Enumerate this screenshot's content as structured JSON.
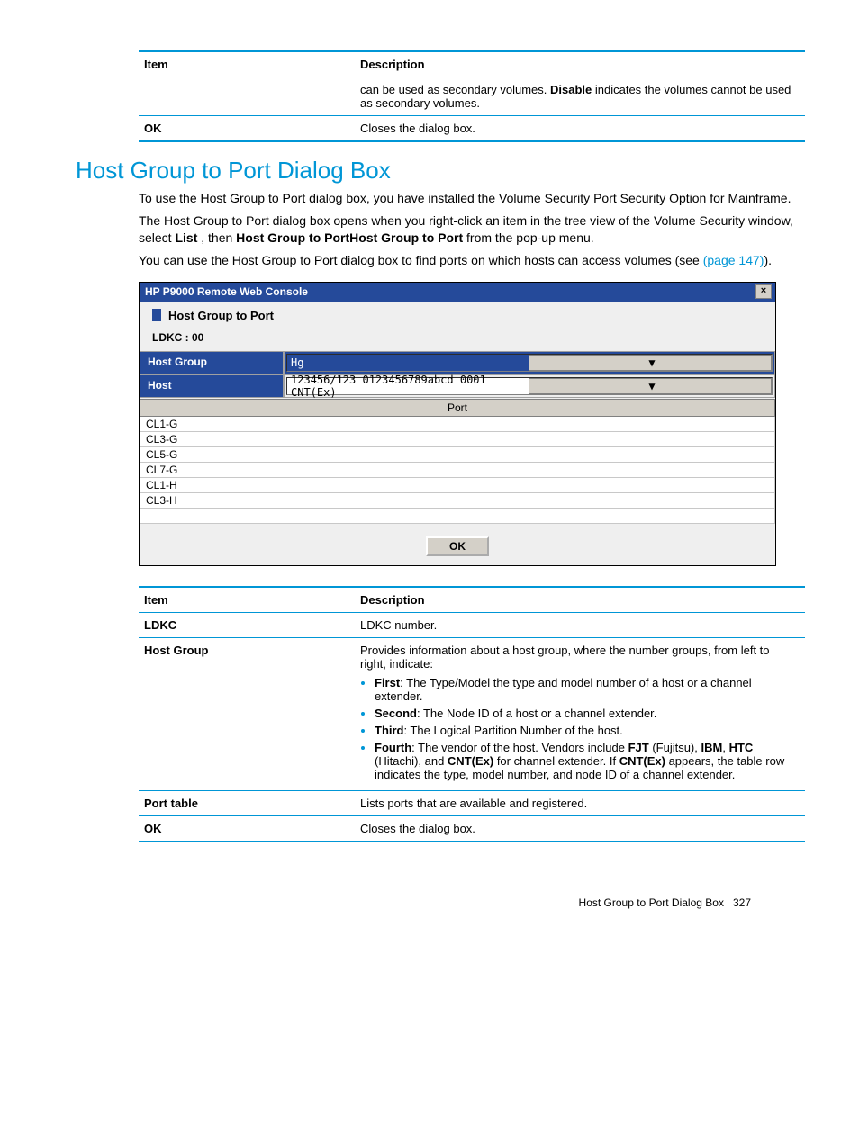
{
  "table1": {
    "headers": [
      "Item",
      "Description"
    ],
    "rows": [
      {
        "item": "",
        "desc_plain_a": "can be used as secondary volumes. ",
        "desc_bold": "Disable",
        "desc_plain_b": " indicates the volumes cannot be used as secondary volumes."
      },
      {
        "item": "OK",
        "desc": "Closes the dialog box."
      }
    ]
  },
  "heading": "Host Group to Port Dialog Box",
  "para1": "To use the Host Group to Port dialog box, you have installed the Volume Security Port Security Option for Mainframe.",
  "para2_a": "The Host Group to Port dialog box opens when you right-click an item in the tree view of the Volume Security window, select ",
  "para2_b1": "List",
  "para2_mid": " , then ",
  "para2_b2": "Host Group to PortHost Group to Port",
  "para2_end": " from the pop-up menu.",
  "para3_a": "You can use the Host Group to Port dialog box to find ports on which hosts can access volumes (see ",
  "para3_link": "(page 147)",
  "para3_b": ").",
  "dialog": {
    "title": "HP P9000 Remote Web Console",
    "header": "Host Group to Port",
    "ldkc": "LDKC : 00",
    "row_hostgroup_label": "Host Group",
    "row_hostgroup_value": "Hg",
    "row_host_label": "Host",
    "row_host_value": "123456/123 0123456789abcd 0001 CNT(Ex)",
    "port_header": "Port",
    "ports": [
      "CL1-G",
      "CL3-G",
      "CL5-G",
      "CL7-G",
      "CL1-H",
      "CL3-H"
    ],
    "ok": "OK"
  },
  "table2": {
    "headers": [
      "Item",
      "Description"
    ],
    "rows": {
      "ldkc": {
        "item": "LDKC",
        "desc": "LDKC number."
      },
      "hostgroup": {
        "item": "Host Group",
        "intro": "Provides information about a host group, where the number groups, from left to right, indicate:",
        "b1": {
          "label": "First",
          "text": ": The Type/Model the type and model number of a host or a channel extender."
        },
        "b2": {
          "label": "Second",
          "text": ": The Node ID of a host or a channel extender."
        },
        "b3": {
          "label": "Third",
          "text": ": The Logical Partition Number of the host."
        },
        "b4": {
          "label": "Fourth",
          "pre": ": The vendor of the host. Vendors include ",
          "v1": "FJT",
          "t1": " (Fujitsu), ",
          "v2": "IBM",
          "t2": ", ",
          "v3": "HTC",
          "t3": " (Hitachi), and ",
          "v4": "CNT(Ex)",
          "t4": " for channel extender. If ",
          "v5": "CNT(Ex)",
          "t5": " appears, the table row indicates the type, model number, and node ID of a channel extender."
        }
      },
      "porttable": {
        "item": "Port table",
        "desc": "Lists ports that are available and registered."
      },
      "ok": {
        "item": "OK",
        "desc": "Closes the dialog box."
      }
    }
  },
  "footer": {
    "text": "Host Group to Port Dialog Box",
    "page": "327"
  }
}
